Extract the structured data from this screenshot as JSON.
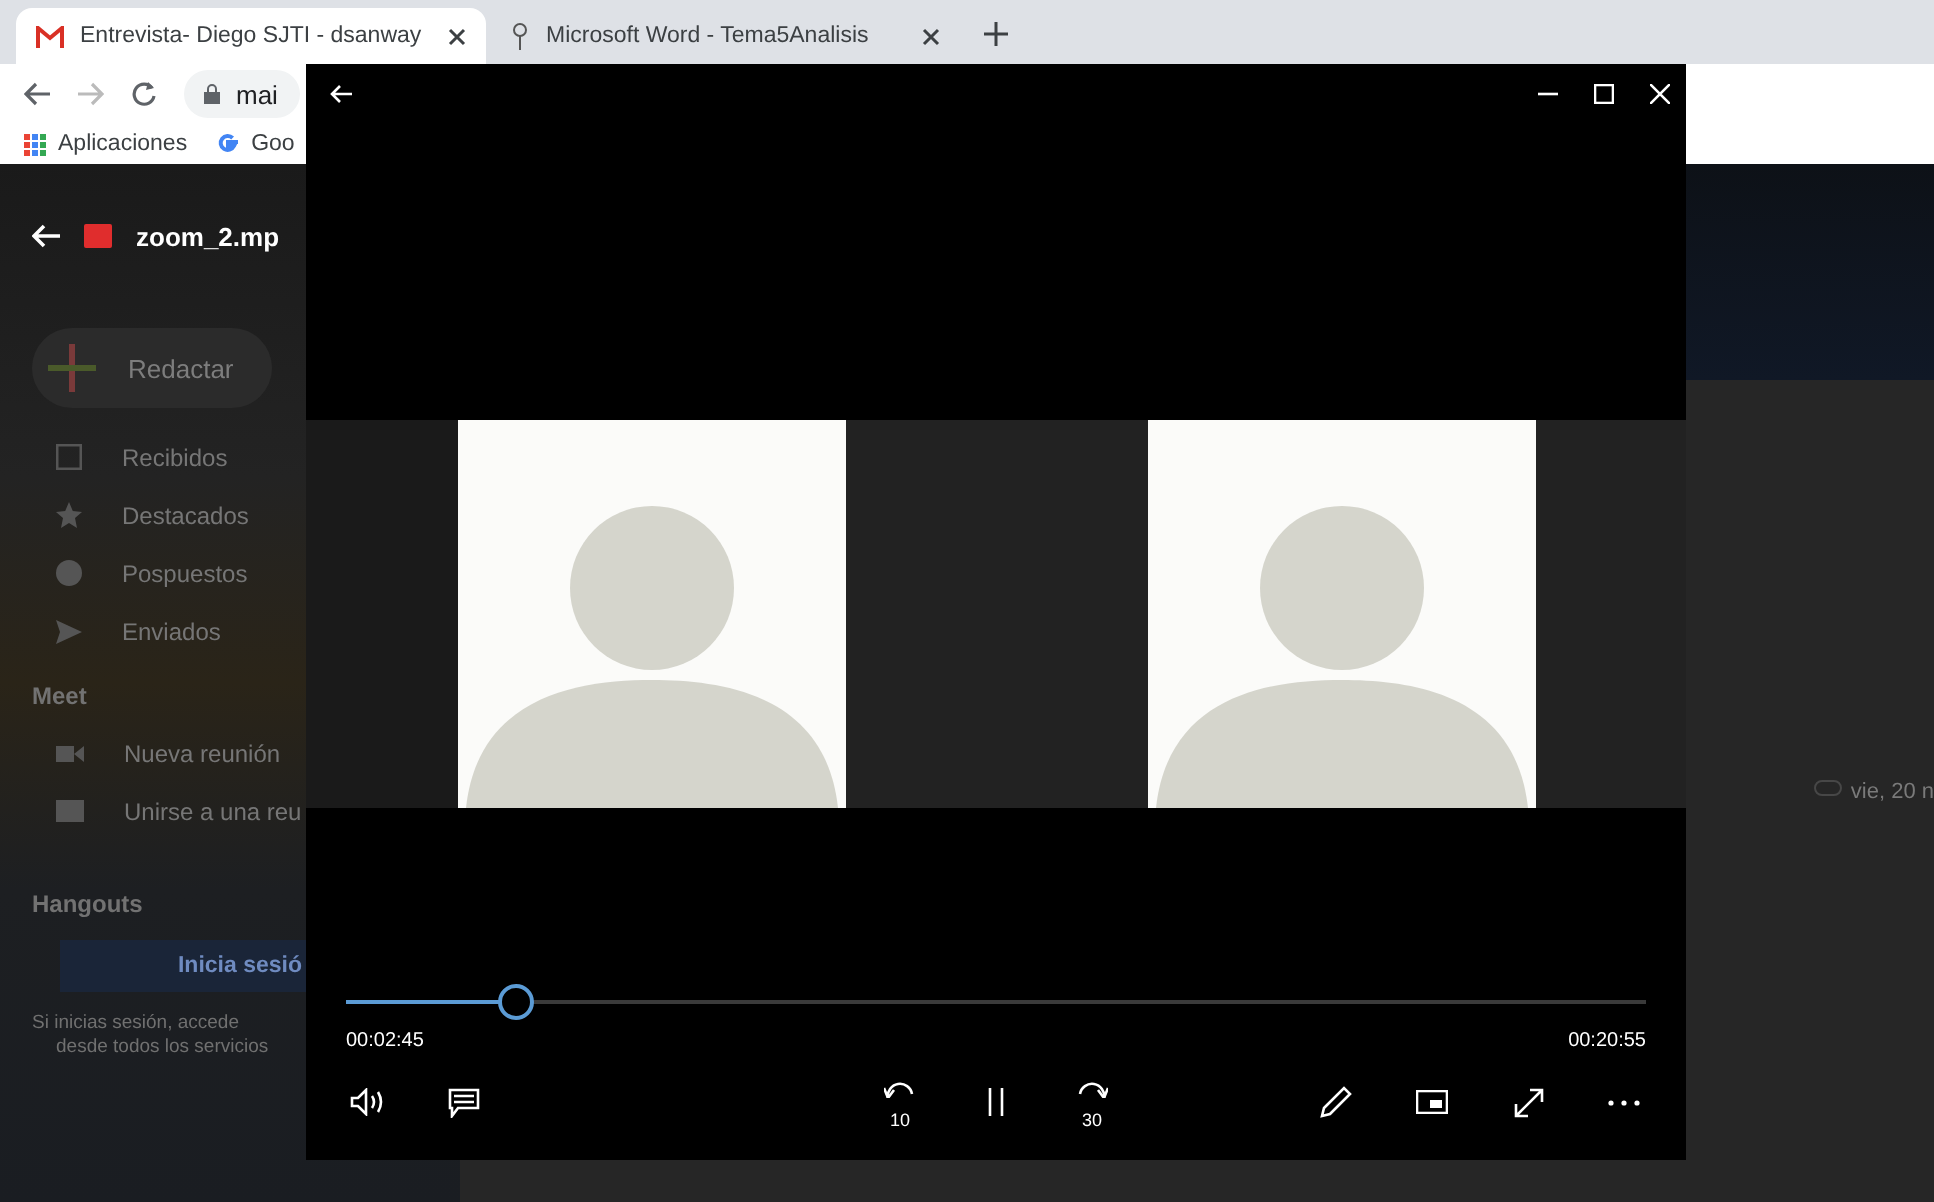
{
  "browser": {
    "tabs": [
      {
        "title": "Entrevista- Diego SJTI - dsanway",
        "selected": true
      },
      {
        "title": "Microsoft Word - Tema5Analisis",
        "selected": false
      }
    ],
    "address": "mai",
    "bookmarks": [
      "Aplicaciones",
      "Goo"
    ]
  },
  "gmail": {
    "file_name": "zoom_2.mp",
    "compose": "Redactar",
    "nav": [
      "Recibidos",
      "Destacados",
      "Pospuestos",
      "Enviados"
    ],
    "meet_heading": "Meet",
    "meet_items": [
      "Nueva reunión",
      "Unirse a una reu"
    ],
    "hangouts_heading": "Hangouts",
    "signin_button": "Inicia sesió",
    "signin_note": [
      "Si inicias sesión, accede",
      "desde todos los servicios"
    ],
    "message_date": "vie, 20 n"
  },
  "player": {
    "progress": {
      "level": 0.13
    },
    "elapsed": "00:02:45",
    "duration": "00:20:55",
    "playing": true,
    "skip_back": "10",
    "skip_forward": "30"
  }
}
